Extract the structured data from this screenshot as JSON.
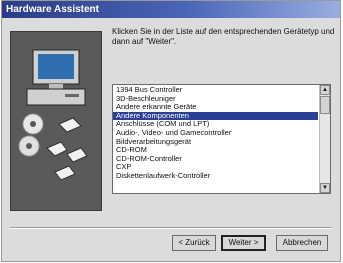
{
  "window": {
    "title": "Hardware Assistent"
  },
  "instruction": "Klicken Sie in der Liste auf den entsprechenden Gerätetyp und dann auf \"Weiter\".",
  "device_list": {
    "items": [
      "1394 Bus Controller",
      "3D-Beschleuniger",
      "Andere erkannte Geräte",
      "Andere Komponenten",
      "Anschlüsse (COM und LPT)",
      "Audio-, Video- und Gamecontroller",
      "Bildverarbeitungsgerät",
      "CD-ROM",
      "CD-ROM-Controller",
      "CXP",
      "Diskettenlaufwerk-Controller"
    ],
    "selected_index": 3
  },
  "buttons": {
    "back": "< Zurück",
    "next": "Weiter >",
    "cancel": "Abbrechen"
  },
  "colors": {
    "title_bar": "#2a3c86",
    "selection": "#2b3f95"
  }
}
